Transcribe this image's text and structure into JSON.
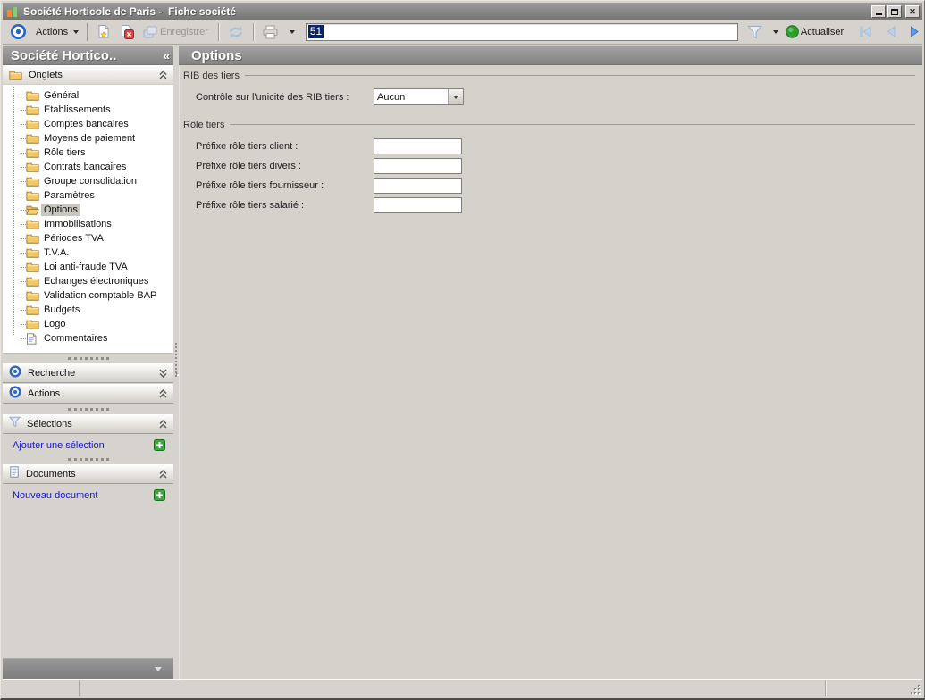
{
  "window": {
    "title": "Société Horticole de Paris -  Fiche société",
    "close_glyph": "✕"
  },
  "toolbar": {
    "actions_label": "Actions",
    "save_label": "Enregistrer",
    "record_value": "51",
    "refresh_label": "Actualiser"
  },
  "sidebar": {
    "header": {
      "title": "Société Hortico..",
      "collapse_glyph": "«"
    },
    "onglets_label": "Onglets",
    "tree_items": [
      {
        "label": "Général",
        "icon": "folder"
      },
      {
        "label": "Etablissements",
        "icon": "folder"
      },
      {
        "label": "Comptes bancaires",
        "icon": "folder"
      },
      {
        "label": "Moyens de paiement",
        "icon": "folder"
      },
      {
        "label": "Rôle tiers",
        "icon": "folder"
      },
      {
        "label": "Contrats bancaires",
        "icon": "folder"
      },
      {
        "label": "Groupe consolidation",
        "icon": "folder"
      },
      {
        "label": "Paramètres",
        "icon": "folder"
      },
      {
        "label": "Options",
        "icon": "folder-open",
        "selected": true
      },
      {
        "label": "Immobilisations",
        "icon": "folder"
      },
      {
        "label": "Périodes TVA",
        "icon": "folder"
      },
      {
        "label": "T.V.A.",
        "icon": "folder"
      },
      {
        "label": "Loi anti-fraude TVA",
        "icon": "folder"
      },
      {
        "label": "Echanges électroniques",
        "icon": "folder"
      },
      {
        "label": "Validation comptable BAP",
        "icon": "folder"
      },
      {
        "label": "Budgets",
        "icon": "folder"
      },
      {
        "label": "Logo",
        "icon": "folder"
      },
      {
        "label": "Commentaires",
        "icon": "note"
      }
    ],
    "panels": [
      {
        "label": "Recherche",
        "icon": "target",
        "chevron": "down",
        "splitter_before": true
      },
      {
        "label": "Actions",
        "icon": "target",
        "chevron": "up",
        "splitter_before": false
      },
      {
        "label": "Sélections",
        "icon": "funnel",
        "chevron": "up",
        "splitter_before": true,
        "link_label": "Ajouter une sélection",
        "add_button": true
      },
      {
        "label": "Documents",
        "icon": "document",
        "chevron": "up",
        "splitter_before": true,
        "link_label": "Nouveau document",
        "add_button": true
      }
    ]
  },
  "main": {
    "header_title": "Options",
    "groups": [
      {
        "title": "RIB des tiers",
        "fields": [
          {
            "label": "Contrôle sur l'unicité des RIB tiers :",
            "type": "select",
            "value": "Aucun"
          }
        ]
      },
      {
        "title": "Rôle tiers",
        "fields": [
          {
            "label": "Préfixe rôle tiers client :",
            "type": "text",
            "value": ""
          },
          {
            "label": "Préfixe rôle tiers divers :",
            "type": "text",
            "value": ""
          },
          {
            "label": "Préfixe rôle tiers fournisseur :",
            "type": "text",
            "value": ""
          },
          {
            "label": "Préfixe rôle tiers salarié :",
            "type": "text",
            "value": ""
          }
        ]
      }
    ]
  },
  "colors": {
    "header_gray": "#8a8a8a",
    "link_blue": "#1717cf",
    "selection_navy": "#0a246a",
    "plus_green": "#44a244",
    "folder_yellow": "#f4c866",
    "accent_blue": "#2a62c8"
  }
}
